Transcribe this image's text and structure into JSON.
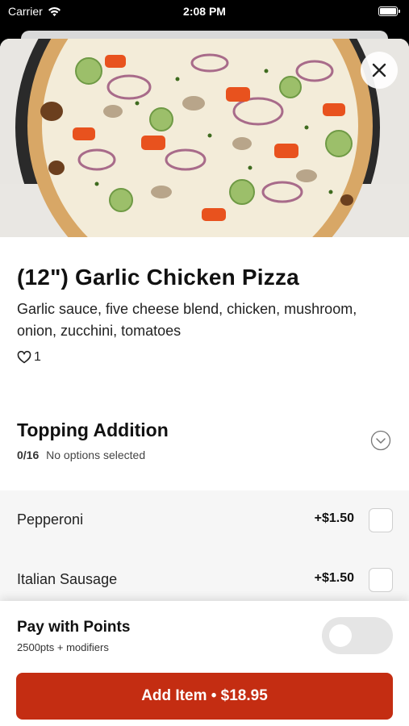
{
  "status_bar": {
    "carrier": "Carrier",
    "time": "2:08 PM"
  },
  "item": {
    "title": "(12\") Garlic Chicken Pizza",
    "description": "Garlic sauce, five cheese blend, chicken, mushroom, onion, zucchini, tomatoes",
    "likes": "1",
    "image_icon": "pizza-photo",
    "close_icon": "close-icon"
  },
  "topping_section": {
    "title": "Topping Addition",
    "count": "0/16",
    "status": "No options selected",
    "options": [
      {
        "name": "Pepperoni",
        "price": "+$1.50",
        "checked": false
      },
      {
        "name": "Italian Sausage",
        "price": "+$1.50",
        "checked": false
      }
    ]
  },
  "footer": {
    "points_title": "Pay with Points",
    "points_sub": "2500pts + modifiers",
    "pay_with_points_enabled": false,
    "add_button": "Add Item • $18.95"
  },
  "colors": {
    "accent": "#c42d12",
    "options_background": "#f6f6f6"
  }
}
